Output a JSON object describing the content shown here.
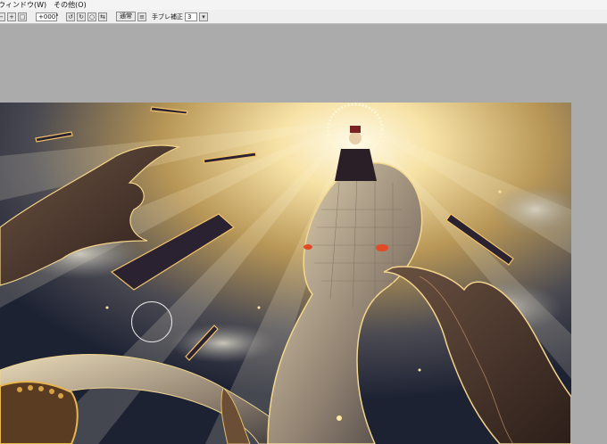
{
  "menu": {
    "items": [
      {
        "label": "ウィンドウ(W)"
      },
      {
        "label": "その他(O)"
      }
    ]
  },
  "toolbar": {
    "rotation_value": "+000°",
    "blend_mode_label": "通常",
    "stabilizer_label": "手ブレ補正",
    "stabilizer_value": "3"
  },
  "icons": {
    "rotate_left": "rotate-left-icon",
    "rotate_right": "rotate-right-icon",
    "reset_rotation": "reset-rotation-icon",
    "flip": "flip-horizontal-icon",
    "blend": "blend-mode-icon",
    "stabilizer": "stabilizer-dropdown-icon"
  },
  "colors": {
    "workspace": "#ababab",
    "menubar": "#f4f4f4",
    "toolbar": "#efefef"
  }
}
